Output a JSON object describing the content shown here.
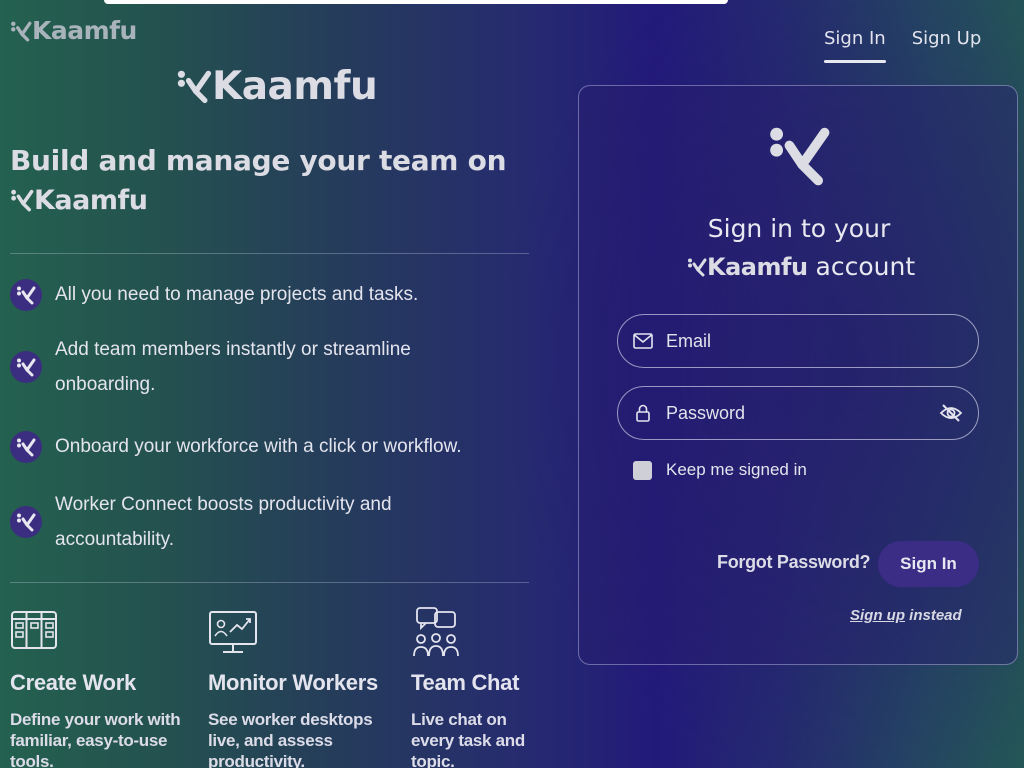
{
  "brand": {
    "name": "kaamfu",
    "small_logo_text": "Kaamfu",
    "big_logo_text": "Kaamfu"
  },
  "left": {
    "headline": "Build and manage your team on",
    "headline_logo_text": "Kaamfu",
    "features": [
      {
        "icon": "kaamfu-mark-icon",
        "text": "All you need to manage projects and tasks."
      },
      {
        "icon": "kaamfu-mark-icon",
        "text": "Add team members instantly or streamline onboarding."
      },
      {
        "icon": "kaamfu-mark-icon",
        "text": "Onboard your workforce with a click or workflow."
      },
      {
        "icon": "kaamfu-mark-icon",
        "text": "Worker Connect boosts productivity and accountability."
      }
    ],
    "columns": [
      {
        "icon": "kanban-board-icon",
        "title": "Create Work",
        "desc": "Define your work with familiar, easy-to-use tools."
      },
      {
        "icon": "monitor-chart-icon",
        "title": "Monitor Workers",
        "desc": "See worker desktops live, and assess productivity."
      },
      {
        "icon": "team-chat-icon",
        "title": "Team Chat",
        "desc": "Live chat on every task and topic."
      }
    ]
  },
  "nav": {
    "sign_in": "Sign In",
    "sign_up": "Sign Up",
    "active": "sign_in"
  },
  "card": {
    "title_line1": "Sign in to your",
    "title_logo_text": "Kaamfu",
    "title_line2_suffix": "account",
    "email_placeholder": "Email",
    "password_placeholder": "Password",
    "remember_label": "Keep me signed in",
    "remember_checked": false,
    "forgot_label": "Forgot Password?",
    "submit_label": "Sign In",
    "signup_link": "Sign up",
    "signup_suffix": " instead"
  },
  "colors": {
    "accent": "#3b2c86",
    "text": "#e4e4ee",
    "logo": "#dcdce4"
  }
}
